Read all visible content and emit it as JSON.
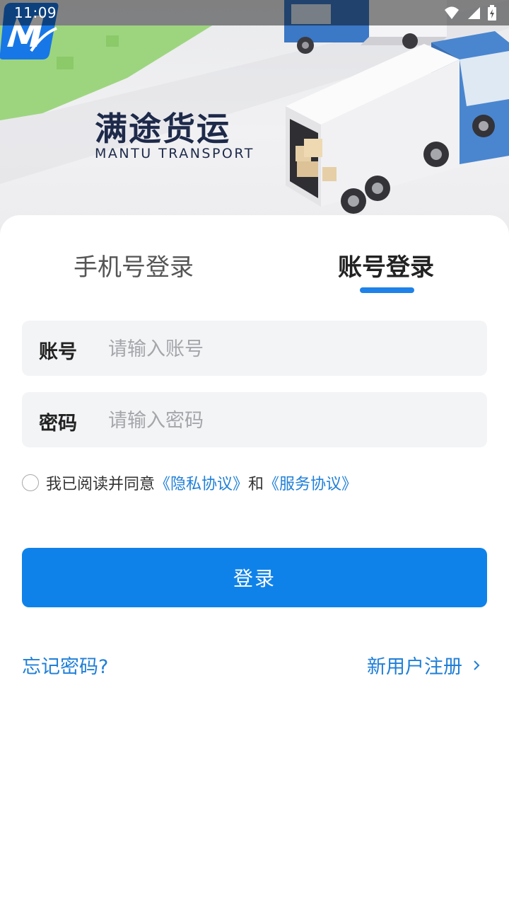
{
  "status_bar": {
    "time": "11:09",
    "icons": [
      "wifi-icon",
      "signal-icon",
      "battery-charging-icon"
    ]
  },
  "brand": {
    "name_cn": "满途货运",
    "name_en": "MANTU TRANSPORT",
    "colors": {
      "primary": "#0f82ea",
      "logo_blue": "#1877e6",
      "logo_text": "#1e2a4a"
    }
  },
  "tabs": [
    {
      "label": "手机号登录",
      "selected": false
    },
    {
      "label": "账号登录",
      "selected": true
    }
  ],
  "form": {
    "account_label": "账号",
    "account_placeholder": "请输入账号",
    "account_value": "",
    "password_label": "密码",
    "password_placeholder": "请输入密码",
    "password_value": ""
  },
  "agreement": {
    "checked": false,
    "prefix": "我已阅读并同意",
    "privacy": "《隐私协议》",
    "conjunction": "和",
    "service": "《服务协议》"
  },
  "login_button": "登录",
  "links": {
    "forgot_password": "忘记密码?",
    "register": "新用户注册"
  }
}
